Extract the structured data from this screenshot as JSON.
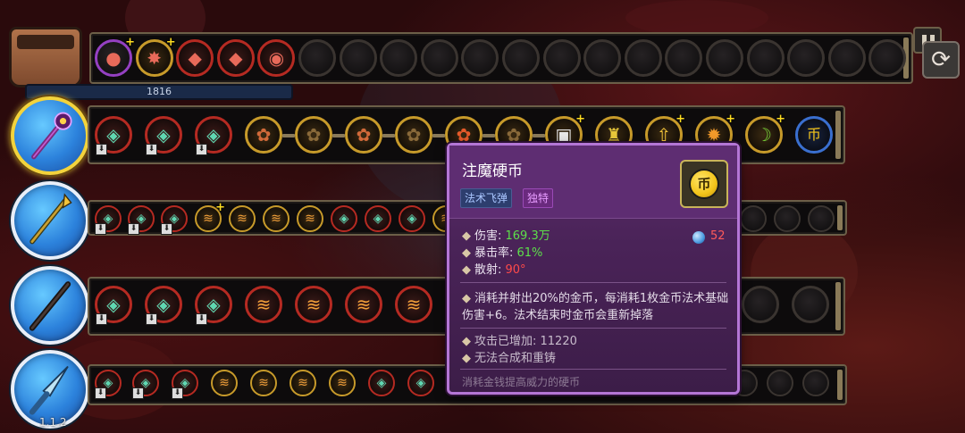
{
  "mana": {
    "value": "1816"
  },
  "version": "1.1.2",
  "inventory": {
    "items": [
      {
        "icon": "ladybug-icon",
        "plus": true,
        "color": "purple"
      },
      {
        "icon": "spiked-burst-icon",
        "plus": true,
        "color": "gold"
      },
      {
        "icon": "crystal-shard-icon",
        "plus": false,
        "color": "red"
      },
      {
        "icon": "crystal-shard-icon",
        "plus": false,
        "color": "red"
      },
      {
        "icon": "rune-orb-icon",
        "plus": false,
        "color": "red"
      }
    ],
    "empty_slots": 15
  },
  "wands": [
    {
      "name": "purple-staff",
      "active": true
    },
    {
      "name": "golden-spear",
      "active": false
    },
    {
      "name": "dark-wand",
      "active": false
    },
    {
      "name": "crystal-dagger",
      "active": false
    }
  ],
  "tooltip": {
    "title": "注魔硬币",
    "tags": [
      "法术飞弹",
      "独特"
    ],
    "icon_glyph": "币",
    "mana_cost": "52",
    "stats": [
      {
        "label": "伤害: ",
        "value": "169.3万",
        "color": "#5de04a"
      },
      {
        "label": "暴击率: ",
        "value": "61%",
        "color": "#5de04a"
      },
      {
        "label": "散射: ",
        "value": "90°",
        "color": "#ff4a4a"
      }
    ],
    "description": "消耗并射出20%的金币，每消耗1枚金币法术基础伤害+6。法术结束时金币会重新掉落",
    "extra": [
      "攻击已增加: 11220",
      "无法合成和重铸"
    ],
    "flavor": "消耗金钱提高威力的硬币"
  }
}
